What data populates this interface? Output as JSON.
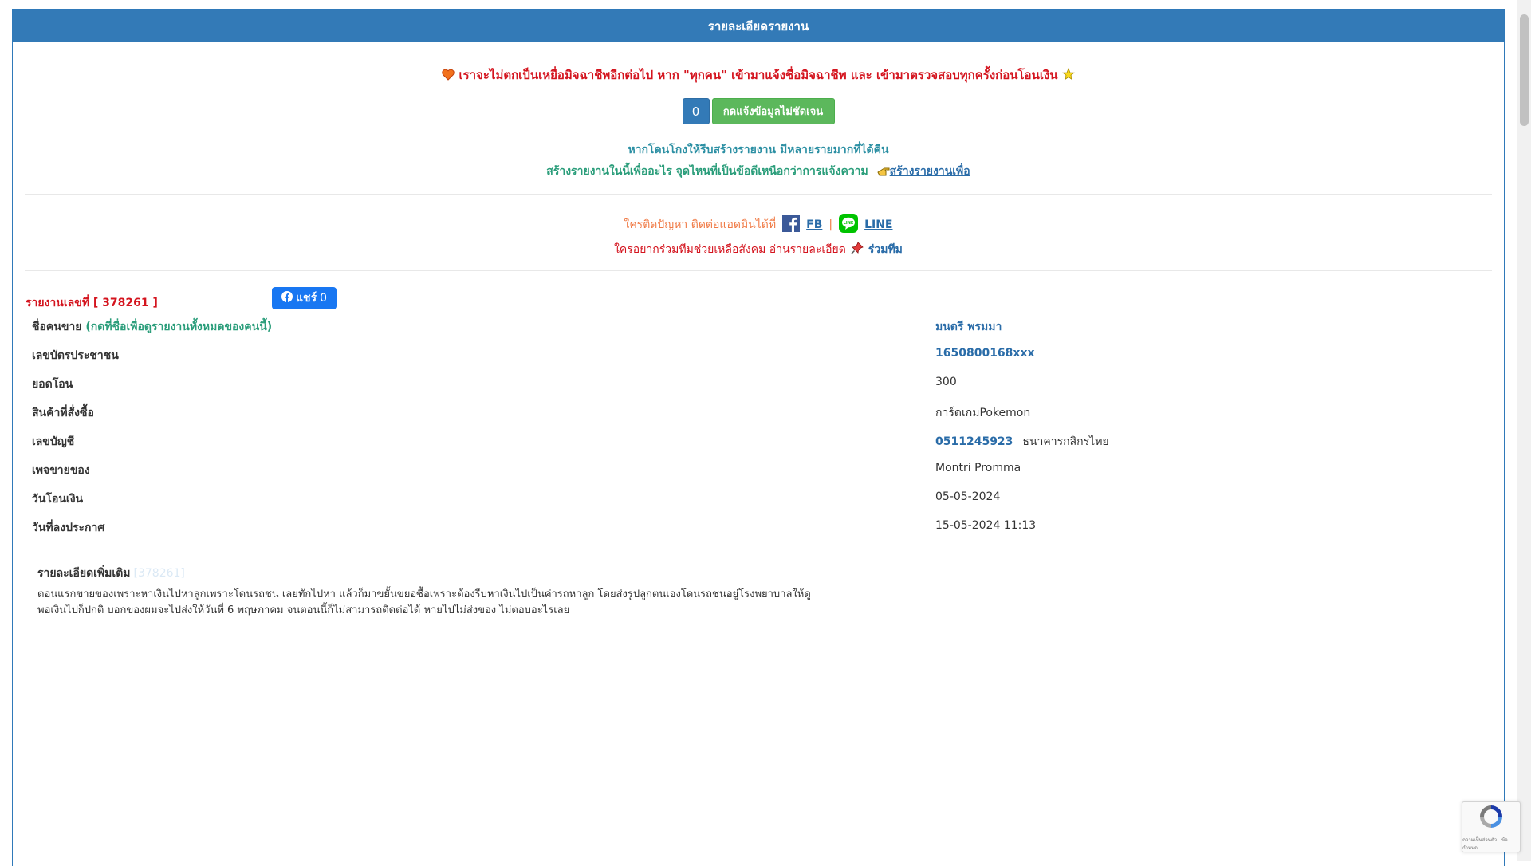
{
  "panel": {
    "title": "รายละเอียดรายงาน"
  },
  "warning": "เราจะไม่ตกเป็นเหยื่อมิจฉาชีพอีกต่อไป หาก \"ทุกคน\" เข้ามาแจ้งชื่อมิจฉาชีพ และ เข้ามาตรวจสอบทุกครั้งก่อนโอนเงิน",
  "buttons": {
    "count": "0",
    "report_unclear": "กดแจ้งข้อมูลไม่ชัดเจน"
  },
  "info": {
    "line1": "หากโดนโกงให้รีบสร้างรายงาน มีหลายรายมากที่ได้คืน",
    "line2": "สร้างรายงานในนี้เพื่ออะไร จุดไหนที่เป็นข้อดีเหนือกว่าการแจ้งความ",
    "link": "สร้างรายงานเพื่อ"
  },
  "contact": {
    "label": "ใครติดปัญหา ติดต่อแอดมินได้ที่",
    "fb": "FB",
    "sep": "|",
    "line": "LINE"
  },
  "join": {
    "label": "ใครอยากร่วมทีมช่วยเหลือสังคม อ่านรายละเอียด",
    "link": "ร่วมทีม"
  },
  "report": {
    "number_label": "รายงานเลขที่ [ 378261 ]",
    "share_label": "แชร์",
    "share_count": "0"
  },
  "rows": [
    {
      "label": "ชื่อคนขาย",
      "hint": "(กดที่ชื่อเพื่อดูรายงานทั้งหมดของคนนี้)",
      "value": "มนตรี พรมมา"
    },
    {
      "label": "เลขบัตรประชาชน",
      "value": "1650800168xxx"
    },
    {
      "label": "ยอดโอน",
      "value": "300"
    },
    {
      "label": "สินค้าที่สั่งซื้อ",
      "value": "การ์ดเกมPokemon"
    },
    {
      "label": "เลขบัญชี",
      "value": "0511245923",
      "bank": "ธนาคารกสิกรไทย"
    },
    {
      "label": "เพจขายของ",
      "value": "Montri Promma"
    },
    {
      "label": "วันโอนเงิน",
      "value": "05-05-2024"
    },
    {
      "label": "วันที่ลงประกาศ",
      "value": "15-05-2024 11:13"
    }
  ],
  "extra": {
    "title": "รายละเอียดเพิ่มเติม",
    "faint": "[378261]",
    "line1": "ตอนแรกขายของเพราะหาเงินไปหาลูกเพราะโดนรถชน เลยทักไปหา แล้วก็มาขยั้นขยอซื้อเพราะต้องรีบหาเงินไปเป็นค่ารถหาลูก โดยส่งรูปลูกตนเองโดนรถชนอยู่โรงพยาบาลให้ดู",
    "line2": "พอเงินไปก็ปกติ บอกของผมจะไปส่งให้วันที่ 6 พฤษภาคม จนตอนนี้ก็ไม่สามารถติดต่อได้ หายไปไม่ส่งของ ไม่ตอบอะไรเลย"
  },
  "captcha": {
    "text": "ความเป็นส่วนตัว - ข้อกำหนด"
  }
}
